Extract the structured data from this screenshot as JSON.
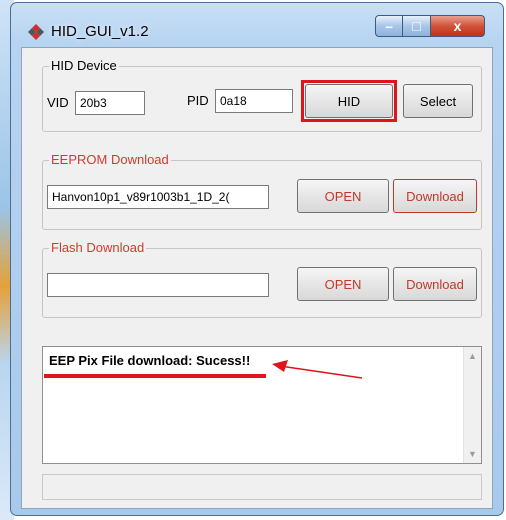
{
  "window": {
    "title": "HID_GUI_v1.2",
    "minimize": "–",
    "maximize": "□",
    "close": "x"
  },
  "hid_device": {
    "legend": "HID Device",
    "vid_label": "VID",
    "vid_value": "20b3",
    "pid_label": "PID",
    "pid_value": "0a18",
    "hid_button": "HID",
    "select_button": "Select"
  },
  "eeprom": {
    "legend": "EEPROM Download",
    "file_value": "Hanvon10p1_v89r1003b1_1D_2(",
    "open_button": "OPEN",
    "download_button": "Download"
  },
  "flash": {
    "legend": "Flash Download",
    "file_value": "",
    "open_button": "OPEN",
    "download_button": "Download"
  },
  "log": {
    "message": "EEP Pix File download: Sucess!!"
  },
  "colors": {
    "annotation_red": "#e0141b",
    "legend_red": "#d13b2b"
  }
}
